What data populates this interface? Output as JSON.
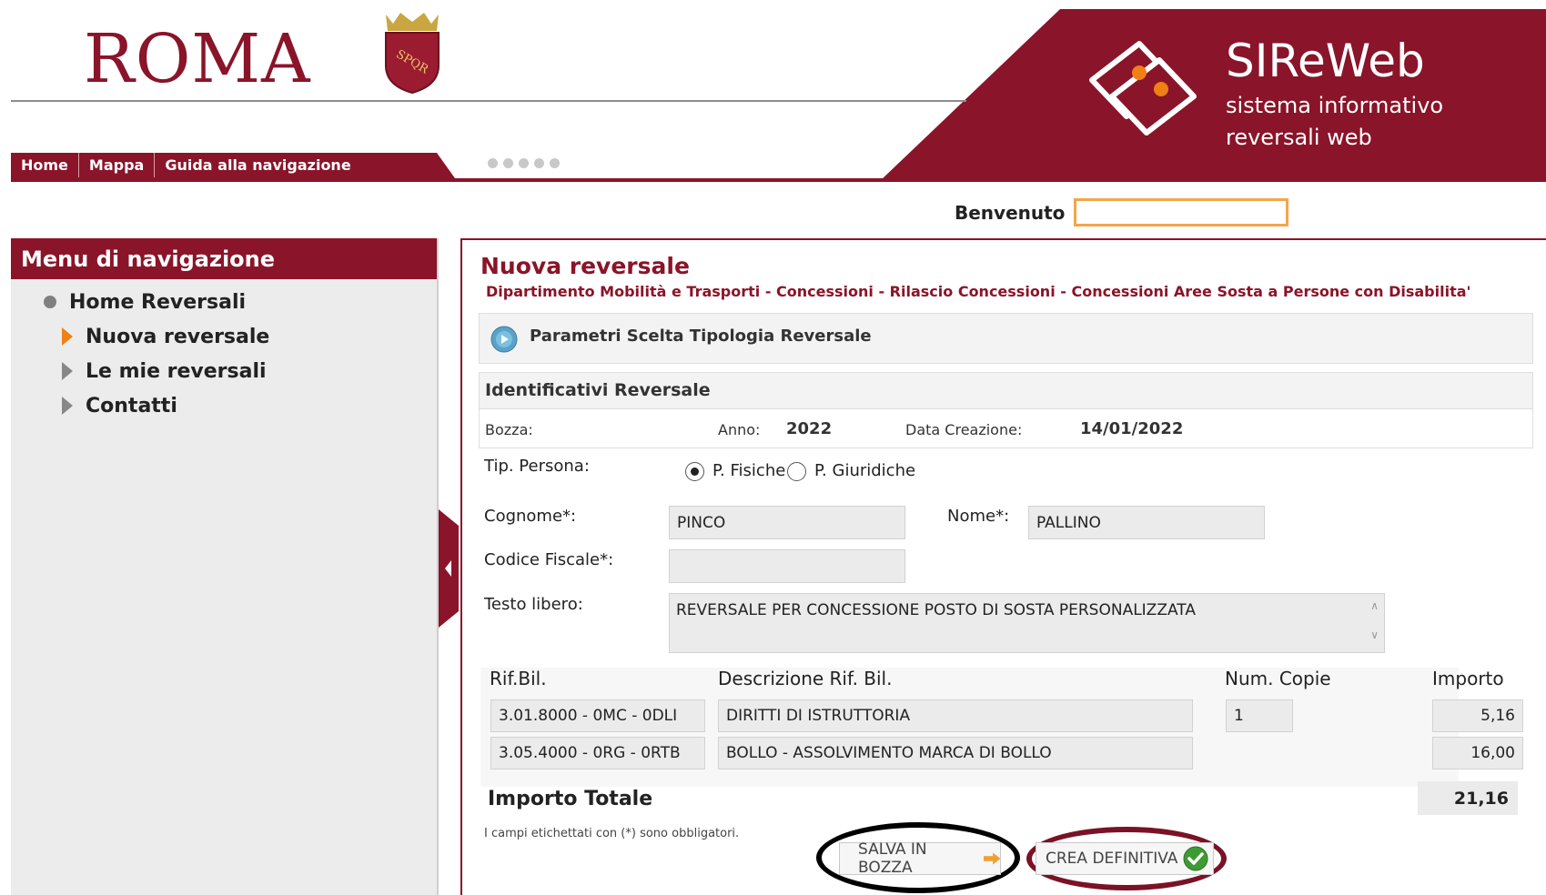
{
  "header": {
    "city_logo": "ROMA",
    "brand_title": "SIReWeb",
    "brand_sub1": "sistema informativo",
    "brand_sub2": "reversali web",
    "nav": [
      "Home",
      "Mappa",
      "Guida alla navigazione"
    ],
    "welcome_label": "Benvenuto",
    "welcome_value": "",
    "shield_text": "SPQR"
  },
  "colors": {
    "brand": "#8a1429",
    "accent": "#f5a54b",
    "orange": "#f07f16"
  },
  "sidebar": {
    "title": "Menu di navigazione",
    "items": [
      {
        "label": "Home Reversali",
        "icon": "bullet-icon"
      },
      {
        "label": "Nuova reversale",
        "icon": "triangle-icon",
        "active": true
      },
      {
        "label": "Le mie reversali",
        "icon": "triangle-icon"
      },
      {
        "label": "Contatti",
        "icon": "triangle-icon"
      }
    ]
  },
  "main": {
    "title": "Nuova reversale",
    "breadcrumb": "Dipartimento Mobilità e Trasporti - Concessioni - Rilascio Concessioni - Concessioni Aree Sosta a Persone con Disabilita'",
    "params_label": "Parametri Scelta Tipologia Reversale",
    "ident": {
      "header": "Identificativi Reversale",
      "bozza_label": "Bozza:",
      "anno_label": "Anno:",
      "anno_value": "2022",
      "data_label": "Data Creazione:",
      "data_value": "14/01/2022"
    },
    "form": {
      "tip_persona_label": "Tip. Persona:",
      "radio_fisiche": "P. Fisiche",
      "radio_giuridiche": "P. Giuridiche",
      "selected_persona": "P. Fisiche",
      "cognome_label": "Cognome*:",
      "cognome_value": "PINCO",
      "nome_label": "Nome*:",
      "nome_value": "PALLINO",
      "cf_label": "Codice Fiscale*:",
      "cf_value": "",
      "testo_label": "Testo libero:",
      "testo_value": "REVERSALE PER CONCESSIONE POSTO DI SOSTA PERSONALIZZATA"
    },
    "table": {
      "headers": [
        "Rif.Bil.",
        "Descrizione Rif. Bil.",
        "Num. Copie",
        "Importo"
      ],
      "rows": [
        {
          "rif": "3.01.8000 - 0MC - 0DLI",
          "desc": "DIRITTI DI ISTRUTTORIA",
          "copie": "1",
          "importo": "5,16"
        },
        {
          "rif": "3.05.4000 - 0RG - 0RTB",
          "desc": "BOLLO - ASSOLVIMENTO MARCA DI BOLLO",
          "copie": "",
          "importo": "16,00"
        }
      ]
    },
    "total_label": "Importo Totale",
    "total_value": "21,16",
    "note": "I campi etichettati con (*) sono obbligatori.",
    "save_button": "SALVA IN BOZZA",
    "define_button": "CREA DEFINITIVA"
  }
}
